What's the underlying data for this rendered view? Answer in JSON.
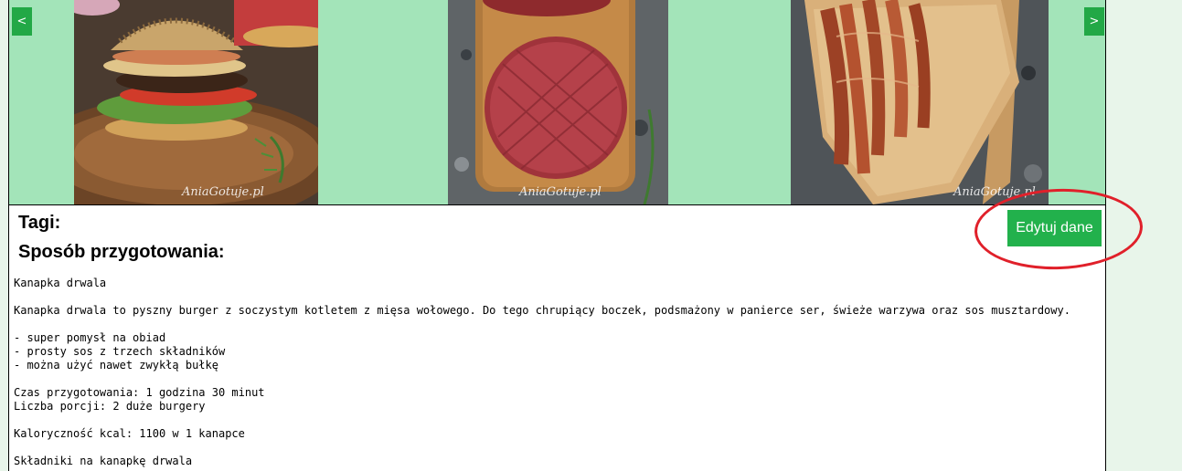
{
  "carousel": {
    "prev_label": "<",
    "next_label": ">",
    "watermark": "AniaGotuje.pl"
  },
  "recipe": {
    "tags_heading": "Tagi:",
    "prep_heading": "Sposób przygotowania:",
    "edit_label": "Edytuj dane",
    "lines": [
      "Kanapka drwala",
      "",
      "Kanapka drwala to pyszny burger z soczystym kotletem z mięsa wołowego. Do tego chrupiący boczek, podsmażony w panierce ser, świeże warzywa oraz sos musztardowy.",
      "",
      "- super pomysł na obiad",
      "- prosty sos z trzech składników",
      "- można użyć nawet zwykłą bułkę",
      "",
      "Czas przygotowania: 1 godzina 30 minut",
      "Liczba porcji: 2 duże burgery",
      "",
      "Kaloryczność kcal: 1100 w 1 kanapce",
      "",
      "Składniki na kanapkę drwala"
    ]
  },
  "colors": {
    "carousel_bg": "#a3e4b9",
    "button_green": "#22b14c",
    "highlight_red": "#e0202a",
    "page_bg": "#e8f5ea"
  }
}
